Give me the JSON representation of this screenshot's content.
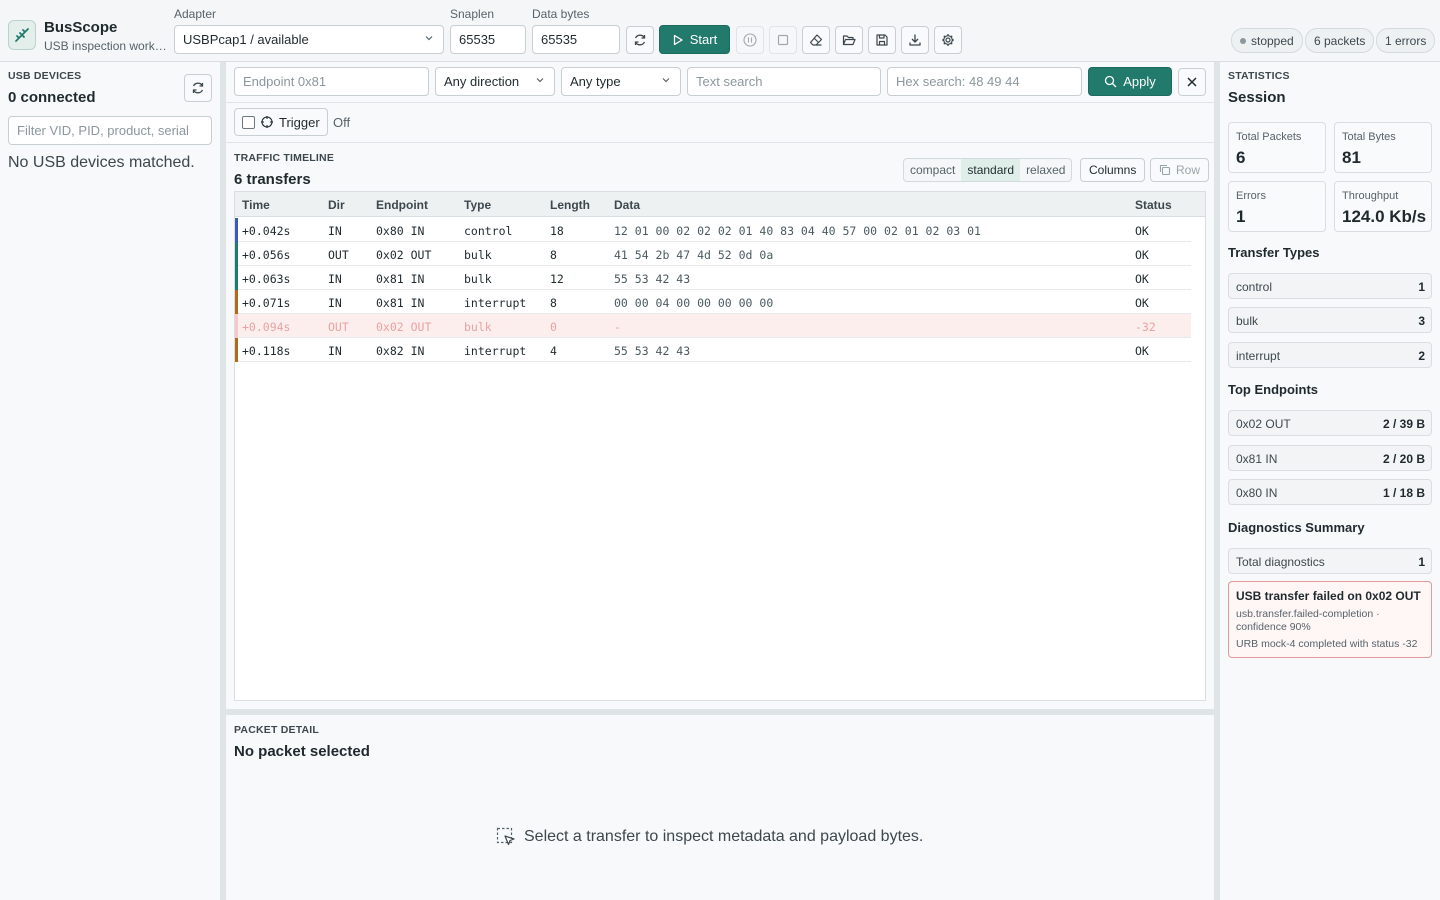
{
  "app": {
    "name": "BusScope",
    "subtitle": "USB inspection workspace"
  },
  "toolbar": {
    "adapter_label": "Adapter",
    "adapter_value": "USBPcap1 / available",
    "snaplen_label": "Snaplen",
    "snaplen_value": "65535",
    "databytes_label": "Data bytes",
    "databytes_value": "65535",
    "start_label": "Start"
  },
  "status": {
    "state": "stopped",
    "packets": "6 packets",
    "errors": "1 errors"
  },
  "devices": {
    "section": "USB DEVICES",
    "count": "0 connected",
    "filter_placeholder": "Filter VID, PID, product, serial",
    "empty": "No USB devices matched."
  },
  "filters": {
    "endpoint_placeholder": "Endpoint 0x81",
    "direction": "Any direction",
    "type": "Any type",
    "text_placeholder": "Text search",
    "hex_placeholder": "Hex search: 48 49 44",
    "apply": "Apply",
    "trigger": "Trigger",
    "trigger_state": "Off"
  },
  "timeline": {
    "section": "TRAFFIC TIMELINE",
    "title": "6 transfers",
    "density": [
      "compact",
      "standard",
      "relaxed"
    ],
    "density_selected": "standard",
    "columns_btn": "Columns",
    "row_btn": "Row",
    "headers": [
      "Time",
      "Dir",
      "Endpoint",
      "Type",
      "Length",
      "Data",
      "Status"
    ],
    "rows": [
      {
        "time": "+0.042s",
        "dir": "IN",
        "endpoint": "0x80 IN",
        "type": "control",
        "length": "18",
        "data": "12 01 00 02 02 02 01 40 83 04 40 57 00 02 01 02 03 01",
        "status": "OK",
        "stripe": "#3b5bb5",
        "error": false
      },
      {
        "time": "+0.056s",
        "dir": "OUT",
        "endpoint": "0x02 OUT",
        "type": "bulk",
        "length": "8",
        "data": "41 54 2b 47 4d 52 0d 0a",
        "status": "OK",
        "stripe": "#227a6c",
        "error": false
      },
      {
        "time": "+0.063s",
        "dir": "IN",
        "endpoint": "0x81 IN",
        "type": "bulk",
        "length": "12",
        "data": "55 53 42 43",
        "status": "OK",
        "stripe": "#227a6c",
        "error": false
      },
      {
        "time": "+0.071s",
        "dir": "IN",
        "endpoint": "0x81 IN",
        "type": "interrupt",
        "length": "8",
        "data": "00 00 04 00 00 00 00 00",
        "status": "OK",
        "stripe": "#b06a1a",
        "error": false
      },
      {
        "time": "+0.094s",
        "dir": "OUT",
        "endpoint": "0x02 OUT",
        "type": "bulk",
        "length": "0",
        "data": "-",
        "status": "-32",
        "stripe": "#f3c9c9",
        "error": true
      },
      {
        "time": "+0.118s",
        "dir": "IN",
        "endpoint": "0x82 IN",
        "type": "interrupt",
        "length": "4",
        "data": "55 53 42 43",
        "status": "OK",
        "stripe": "#b06a1a",
        "error": false
      }
    ]
  },
  "detail": {
    "section": "PACKET DETAIL",
    "title": "No packet selected",
    "hint": "Select a transfer to inspect metadata and payload bytes."
  },
  "stats": {
    "section": "STATISTICS",
    "title": "Session",
    "total_packets_label": "Total Packets",
    "total_packets": "6",
    "total_bytes_label": "Total Bytes",
    "total_bytes": "81",
    "errors_label": "Errors",
    "errors": "1",
    "throughput_label": "Throughput",
    "throughput": "124.0 Kb/s",
    "transfer_types_title": "Transfer Types",
    "transfer_types": [
      {
        "name": "control",
        "count": "1"
      },
      {
        "name": "bulk",
        "count": "3"
      },
      {
        "name": "interrupt",
        "count": "2"
      }
    ],
    "top_endpoints_title": "Top Endpoints",
    "top_endpoints": [
      {
        "name": "0x02 OUT",
        "value": "2 / 39 B"
      },
      {
        "name": "0x81 IN",
        "value": "2 / 20 B"
      },
      {
        "name": "0x80 IN",
        "value": "1 / 18 B"
      }
    ],
    "diagnostics_title": "Diagnostics Summary",
    "total_diag_label": "Total diagnostics",
    "total_diag": "1",
    "diag_title": "USB transfer failed on 0x02 OUT",
    "diag_meta": "usb.transfer.failed-completion · confidence 90%",
    "diag_detail": "URB mock-4 completed with status -32"
  }
}
